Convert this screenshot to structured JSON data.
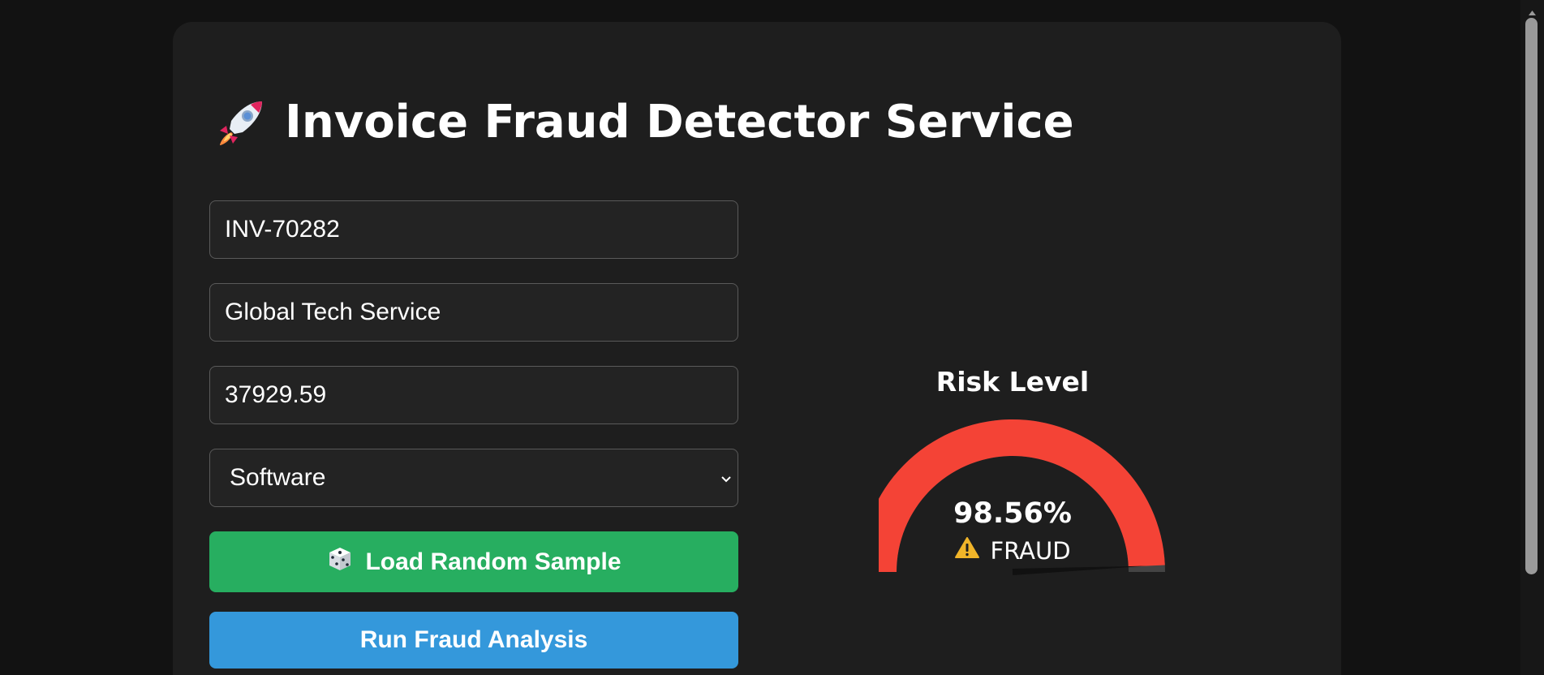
{
  "app": {
    "title": "Invoice Fraud Detector Service",
    "title_icon": "rocket-icon"
  },
  "form": {
    "invoice_id": "INV-70282",
    "vendor": "Global Tech Service",
    "amount": "37929.59",
    "category": {
      "selected": "Software"
    },
    "random_button": {
      "icon": "dice-icon",
      "label": "Load Random Sample"
    },
    "run_button": {
      "label": "Run Fraud Analysis"
    }
  },
  "gauge": {
    "title": "Risk Level",
    "percent_label": "98.56%",
    "value": 98.56,
    "max": 100,
    "status_icon": "warning-icon",
    "status_label": "FRAUD",
    "color": "#f44336"
  },
  "colors": {
    "background": "#121212",
    "card": "#1e1e1e",
    "random_button": "#27ae60",
    "run_button": "#3498db",
    "gauge_fill": "#f44336",
    "warning": "#f0b429"
  }
}
